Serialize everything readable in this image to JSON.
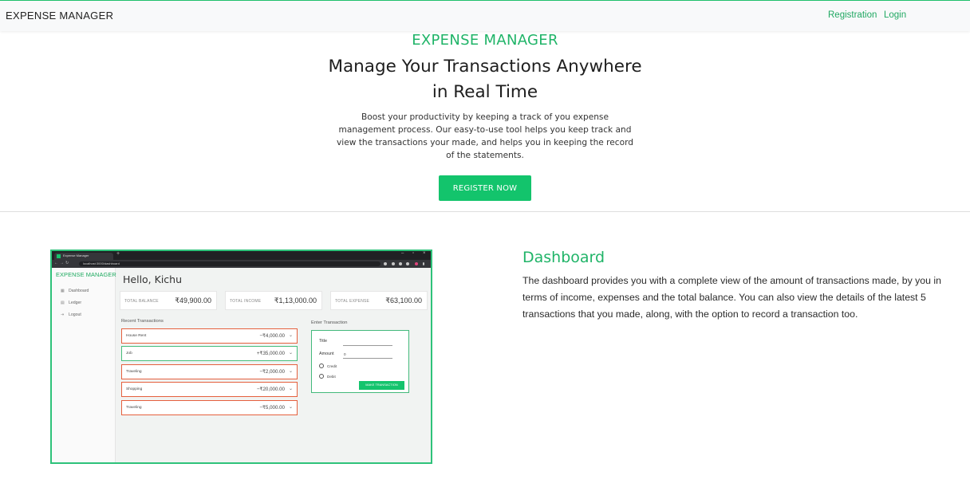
{
  "navbar": {
    "brand": "EXPENSE MANAGER",
    "links": [
      "Registration",
      "Login"
    ]
  },
  "hero": {
    "tag": "EXPENSE MANAGER",
    "title": "Manage Your Transactions Anywhere in Real Time",
    "description": "Boost your productivity by keeping a track of you expense management process. Our easy-to-use tool helps you keep track and view the transactions your made, and helps you in keeping the record of the statements.",
    "button": "REGISTER NOW"
  },
  "screenshot": {
    "browser": {
      "tab_title": "Expense Manager",
      "url": "localhost:3000/dashboard",
      "window_controls": [
        "–",
        "▫",
        "×"
      ]
    },
    "app": {
      "brand": "EXPENSE MANAGER",
      "sidebar": [
        {
          "icon": "dashboard-icon",
          "label": "Dashboard"
        },
        {
          "icon": "ledger-icon",
          "label": "Ledger"
        },
        {
          "icon": "logout-icon",
          "label": "Logout"
        }
      ],
      "greeting": "Hello, Kichu",
      "stats": [
        {
          "label": "TOTAL BALANCE",
          "value": "₹49,900.00"
        },
        {
          "label": "TOTAL INCOME",
          "value": "₹1,13,000.00"
        },
        {
          "label": "TOTAL EXPENSE",
          "value": "₹63,100.00"
        }
      ],
      "recent_title": "Recent Transactions",
      "transactions": [
        {
          "title": "House Rent",
          "amount": "−₹4,000.00",
          "type": "debit"
        },
        {
          "title": "Job",
          "amount": "+₹35,000.00",
          "type": "credit"
        },
        {
          "title": "Traveling",
          "amount": "−₹2,000.00",
          "type": "debit"
        },
        {
          "title": "Shopping",
          "amount": "−₹20,000.00",
          "type": "debit"
        },
        {
          "title": "Traveling",
          "amount": "−₹5,000.00",
          "type": "debit"
        }
      ],
      "form": {
        "title": "Enter Transaction",
        "title_label": "Title",
        "amount_label": "Amount",
        "amount_value": "0",
        "radio_credit": "Credit",
        "radio_debit": "Debit",
        "button": "MAKE TRANSACTION"
      }
    }
  },
  "dashboard": {
    "title": "Dashboard",
    "description": "The dashboard provides you with a complete view of the amount of transactions made, by you in terms of income, expenses and the total balance. You can also view the details of the latest 5 transactions that you made, along, with the option to record a transaction too."
  },
  "colors": {
    "accent": "#20b468",
    "button": "#13c46c",
    "debit_border": "#e5603e",
    "credit_border": "#46bd7a"
  }
}
